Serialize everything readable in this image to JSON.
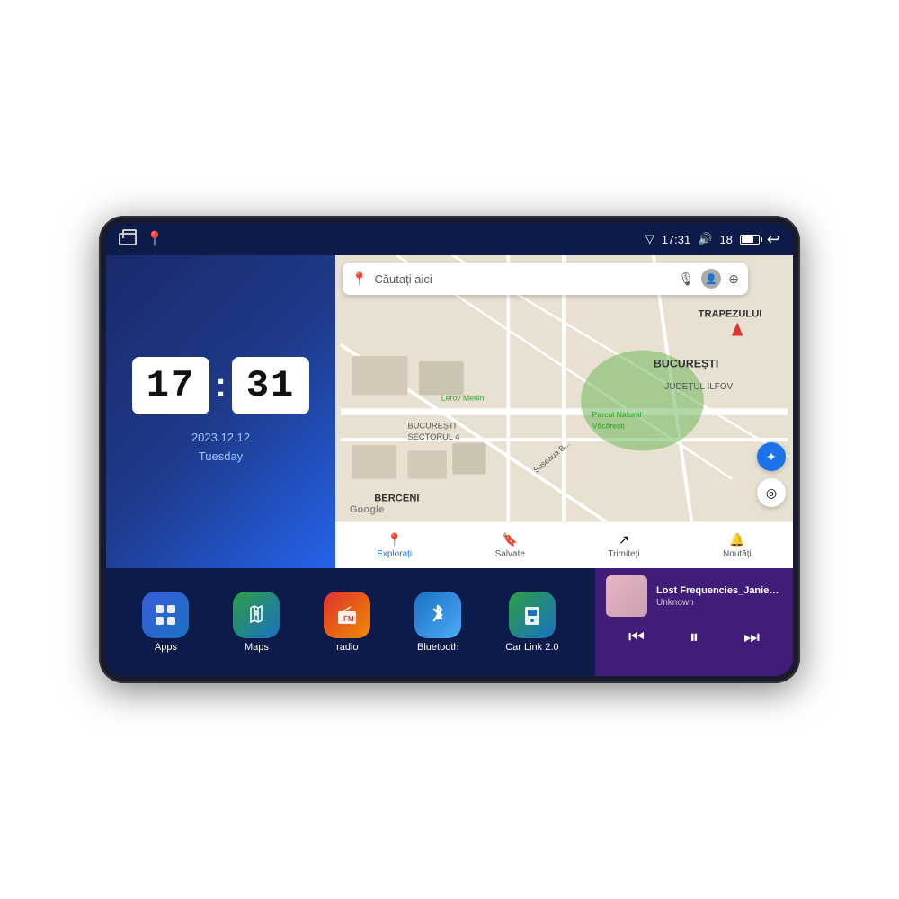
{
  "device": {
    "status_bar": {
      "time": "17:31",
      "signal_strength": "18",
      "home_icon": "⌂",
      "maps_icon": "📍",
      "signal_icon": "▾",
      "volume_icon": "🔊",
      "battery_text": "18",
      "back_icon": "↩"
    },
    "clock": {
      "hour": "17",
      "minute": "31",
      "date": "2023.12.12",
      "day": "Tuesday"
    },
    "map": {
      "search_placeholder": "Căutați aici",
      "search_icon": "📍",
      "voice_icon": "🎙",
      "layers_icon": "⊕",
      "location_icon": "◎",
      "compass_icon": "✦",
      "nav_items": [
        {
          "icon": "📍",
          "label": "Explorați",
          "active": true
        },
        {
          "icon": "🔖",
          "label": "Salvate",
          "active": false
        },
        {
          "icon": "⊕",
          "label": "Trimiteți",
          "active": false
        },
        {
          "icon": "🔔",
          "label": "Noutăți",
          "active": false
        }
      ],
      "labels": [
        "TRAPEZULUI",
        "BUCUREȘTI",
        "JUDEȚUL ILFOV",
        "BERCENI",
        "BUCUREȘTI SECTORUL 4",
        "Leroy Merlin",
        "Parcul Natural Văcărești",
        "Soseaua B..."
      ],
      "google_label": "Google"
    },
    "apps": [
      {
        "id": "apps",
        "label": "Apps",
        "icon": "⊞",
        "color_class": "icon-apps"
      },
      {
        "id": "maps",
        "label": "Maps",
        "icon": "🗺",
        "color_class": "icon-maps"
      },
      {
        "id": "radio",
        "label": "radio",
        "icon": "📻",
        "color_class": "icon-radio"
      },
      {
        "id": "bluetooth",
        "label": "Bluetooth",
        "icon": "⚡",
        "color_class": "icon-bluetooth"
      },
      {
        "id": "carlink",
        "label": "Car Link 2.0",
        "icon": "📱",
        "color_class": "icon-carlink"
      }
    ],
    "music": {
      "title": "Lost Frequencies_Janieck Devy-...",
      "artist": "Unknown",
      "prev_icon": "⏮",
      "play_icon": "⏸",
      "next_icon": "⏭"
    }
  }
}
